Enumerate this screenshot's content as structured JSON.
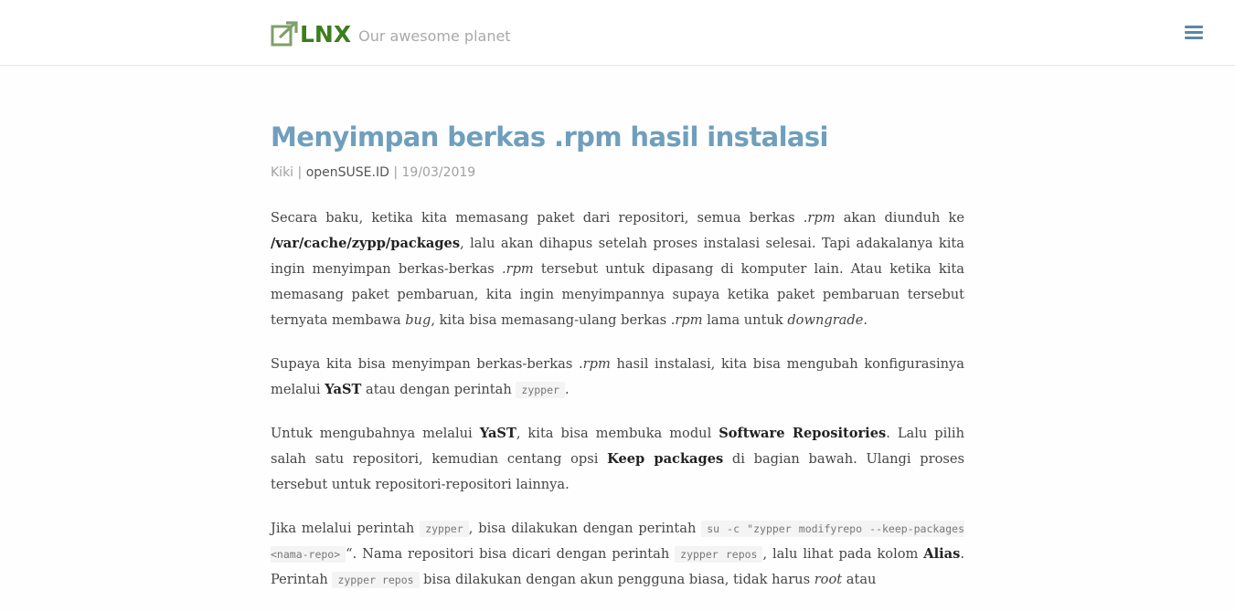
{
  "site": {
    "logo_text": "LNX",
    "tagline": "Our awesome planet"
  },
  "article": {
    "title": "Menyimpan berkas .rpm hasil instalasi",
    "author": "Kiki",
    "category": "openSUSE.ID",
    "date": "19/03/2019",
    "p1": {
      "t1": "Secara baku, ketika kita memasang paket dari repositori, semua berkas ",
      "i1": ".rpm",
      "t2": " akan diunduh ke ",
      "b1": "/var/cache/zypp/packages",
      "t3": ", lalu akan dihapus setelah proses instalasi selesai. Tapi adakalanya kita ingin menyimpan berkas-berkas ",
      "i2": ".rpm",
      "t4": " tersebut untuk dipasang di komputer lain. Atau ketika kita memasang paket pembaruan, kita ingin menyimpannya supaya ketika paket pembaruan tersebut ternyata membawa ",
      "i3": "bug",
      "t5": ", kita bisa memasang-ulang berkas ",
      "i4": ".rpm",
      "t6": " lama untuk ",
      "i5": "downgrade",
      "t7": "."
    },
    "p2": {
      "t1": "Supaya kita bisa menyimpan berkas-berkas ",
      "i1": ".rpm",
      "t2": " hasil instalasi, kita bisa mengubah konfigurasinya melalui ",
      "b1": "YaST",
      "t3": " atau dengan perintah ",
      "c1": "zypper",
      "t4": "."
    },
    "p3": {
      "t1": "Untuk mengubahnya melalui ",
      "b1": "YaST",
      "t2": ", kita bisa membuka modul ",
      "b2": "Software Repositories",
      "t3": ". Lalu pilih salah satu repositori, kemudian centang opsi ",
      "b3": "Keep packages",
      "t4": " di bagian bawah. Ulangi proses tersebut untuk repositori-repositori lainnya."
    },
    "p4": {
      "t1": "Jika melalui perintah ",
      "c1": "zypper",
      "t2": ", bisa dilakukan dengan perintah ",
      "c2": "su -c \"zypper modifyrepo --keep-packages <nama-repo>",
      "t3": "“. Nama repositori bisa dicari dengan perintah ",
      "c3": "zypper repos",
      "t4": ", lalu lihat pada kolom ",
      "b1": "Alias",
      "t5": ". Perintah ",
      "c4": "zypper repos",
      "t6": " bisa dilakukan dengan akun pengguna biasa, tidak harus ",
      "i1": "root",
      "t7": " atau"
    }
  }
}
